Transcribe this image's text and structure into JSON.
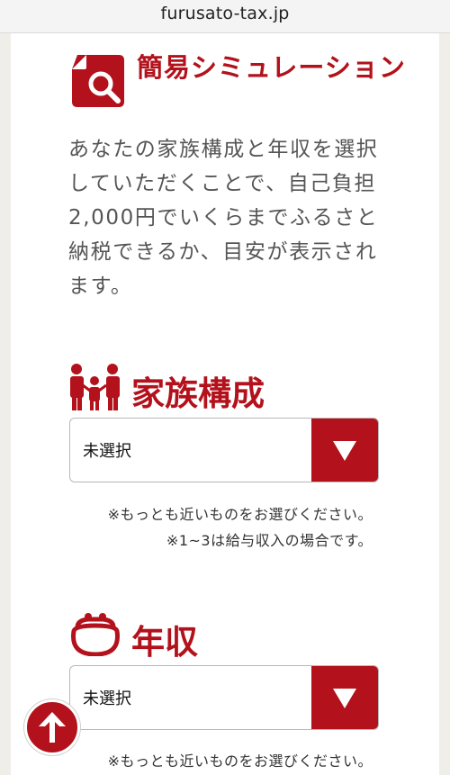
{
  "browser": {
    "url": "furusato-tax.jp"
  },
  "simulation": {
    "title": "簡易シミュレーション",
    "description": "あなたの家族構成と年収を選択していただくことで、自己負担2,000円でいくらまでふるさと納税できるか、目安が表示されます。"
  },
  "family": {
    "heading": "家族構成",
    "select_value": "未選択",
    "note_line1": "※もっとも近いものをお選びください。",
    "note_line2": "※1~3は給与収入の場合です。"
  },
  "income": {
    "heading": "年収",
    "select_value": "未選択",
    "note_line1": "※もっとも近いものをお選びください。"
  },
  "icons": {
    "simulation": "document-search-icon",
    "family": "family-people-icon",
    "income": "coin-purse-icon",
    "dropdown": "triangle-down-icon",
    "scroll_top": "arrow-up-icon"
  },
  "colors": {
    "accent": "#b3111b",
    "page_bg": "#ffffff",
    "frame_bg": "#efeee9"
  }
}
